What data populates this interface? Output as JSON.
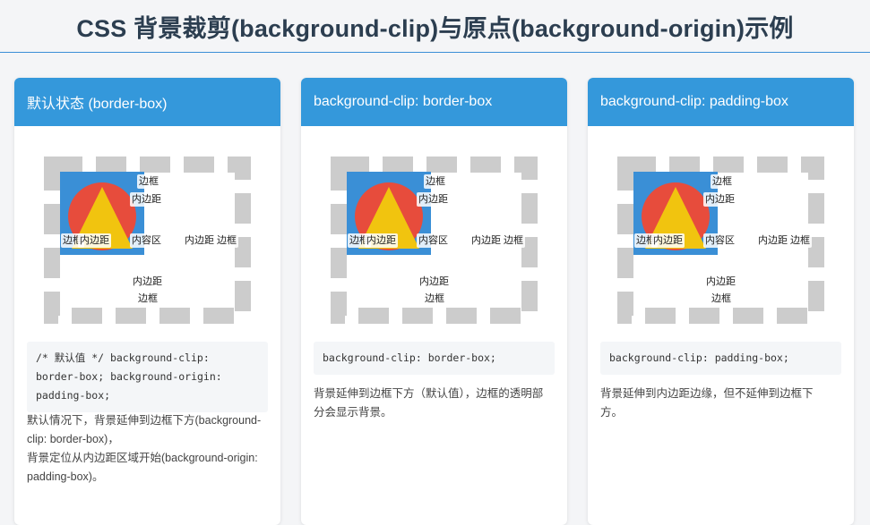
{
  "page": {
    "title": "CSS 背景裁剪(background-clip)与原点(background-origin)示例"
  },
  "colors": {
    "accent": "#3498db",
    "border_dash": "#cccccc",
    "bg_blue": "#3a8fd6",
    "circle_red": "#e74c3c",
    "triangle_yellow": "#f1c40f"
  },
  "labels": {
    "border": "边框",
    "padding": "内边距",
    "content": "内容区",
    "padding_border": "内边距 边框"
  },
  "cards": [
    {
      "title": "默认状态 (border-box)",
      "code": "/* 默认值 */ background-clip: border-box; background-origin: padding-box;",
      "description_line1": "默认情况下，背景延伸到边框下方(background-clip: border-box)，",
      "description_line2": "背景定位从内边距区域开始(background-origin: padding-box)。"
    },
    {
      "title": "background-clip: border-box",
      "code": "background-clip: border-box;",
      "description_line1": "背景延伸到边框下方（默认值），边框的透明部分会显示背景。",
      "description_line2": ""
    },
    {
      "title": "background-clip: padding-box",
      "code": "background-clip: padding-box;",
      "description_line1": "背景延伸到内边距边缘，但不延伸到边框下方。",
      "description_line2": ""
    }
  ]
}
